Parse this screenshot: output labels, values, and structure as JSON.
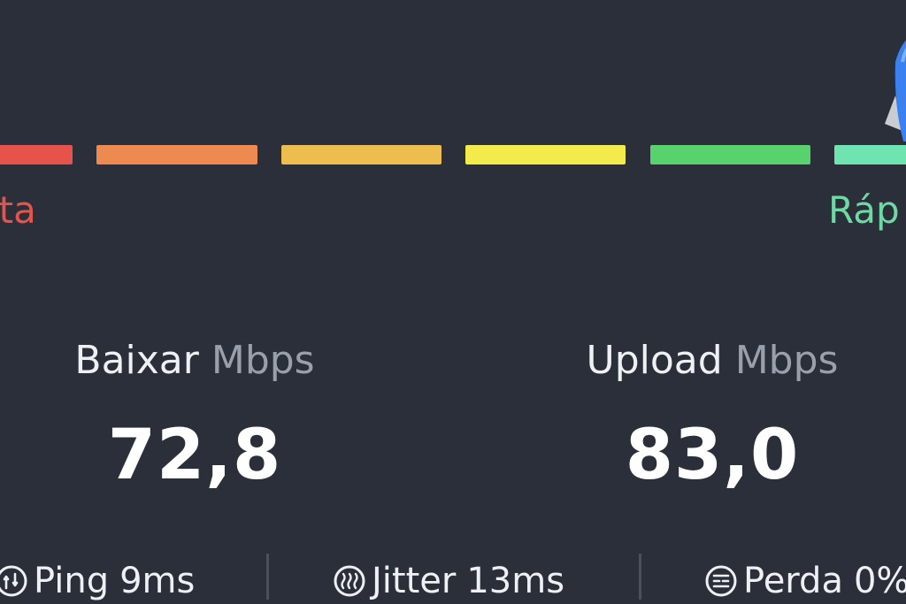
{
  "meter": {
    "segments": [
      {
        "name": "segment-1",
        "color": "#e5534b"
      },
      {
        "name": "segment-2",
        "color": "#ec8a52"
      },
      {
        "name": "segment-3",
        "color": "#eebd4f"
      },
      {
        "name": "segment-4",
        "color": "#f3ea4c"
      },
      {
        "name": "segment-5",
        "color": "#57d26c"
      },
      {
        "name": "segment-6",
        "color": "#6fe3b0"
      }
    ],
    "slow_label": "nta",
    "slow_color": "#e5534b",
    "fast_label": "Ráp",
    "fast_color": "#6fd9a4"
  },
  "download": {
    "label": "Baixar",
    "unit": "Mbps",
    "value": "72,8"
  },
  "upload": {
    "label": "Upload",
    "unit": "Mbps",
    "value": "83,0"
  },
  "metrics": {
    "ping": {
      "icon": "ping-icon",
      "label": "Ping",
      "value": "9ms"
    },
    "jitter": {
      "icon": "jitter-icon",
      "label": "Jitter",
      "value": "13ms"
    },
    "loss": {
      "icon": "packet-loss-icon",
      "label": "Perda",
      "value": "0%"
    }
  },
  "colors": {
    "background": "#2a2f3a",
    "text": "#eef0f3",
    "unit_text": "#9aa0ab",
    "divider": "#4a505c"
  }
}
